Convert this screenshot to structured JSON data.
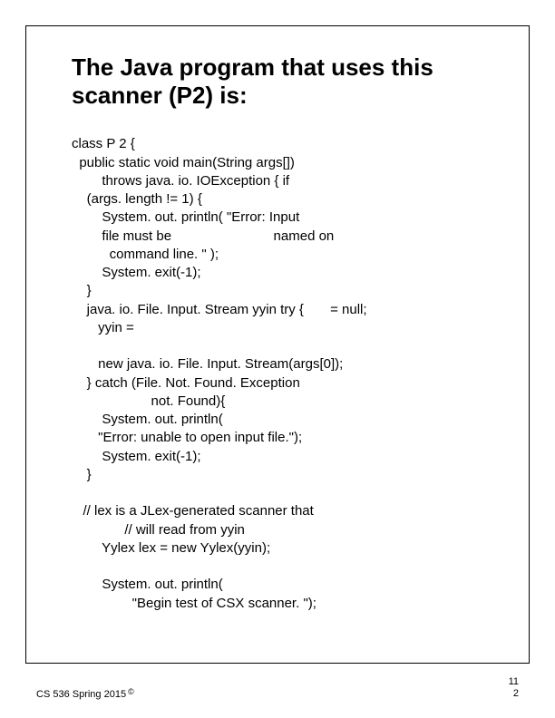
{
  "title": "The Java program that uses this scanner (P2) is:",
  "code_lines": [
    "class P 2 {",
    "  public static void main(String args[])",
    "        throws java. io. IOException { if",
    "    (args. length != 1) {",
    "        System. out. println( \"Error: Input",
    "        file must be                           named on",
    "          command line. \" );",
    "        System. exit(-1);",
    "    }",
    "    java. io. File. Input. Stream yyin try {       = null;",
    "       yyin =",
    "",
    "       new java. io. File. Input. Stream(args[0]);",
    "    } catch (File. Not. Found. Exception",
    "                     not. Found){",
    "        System. out. println(",
    "       \"Error: unable to open input file.\");",
    "        System. exit(-1);",
    "    }",
    "",
    "   // lex is a JLex-generated scanner that",
    "              // will read from yyin",
    "        Yylex lex = new Yylex(yyin);",
    "",
    "        System. out. println(",
    "                \"Begin test of CSX scanner. \");"
  ],
  "footer": {
    "course": "CS 536  Spring 2015",
    "copyright_symbol": "©",
    "page_top": "11",
    "page_bottom": "2"
  }
}
